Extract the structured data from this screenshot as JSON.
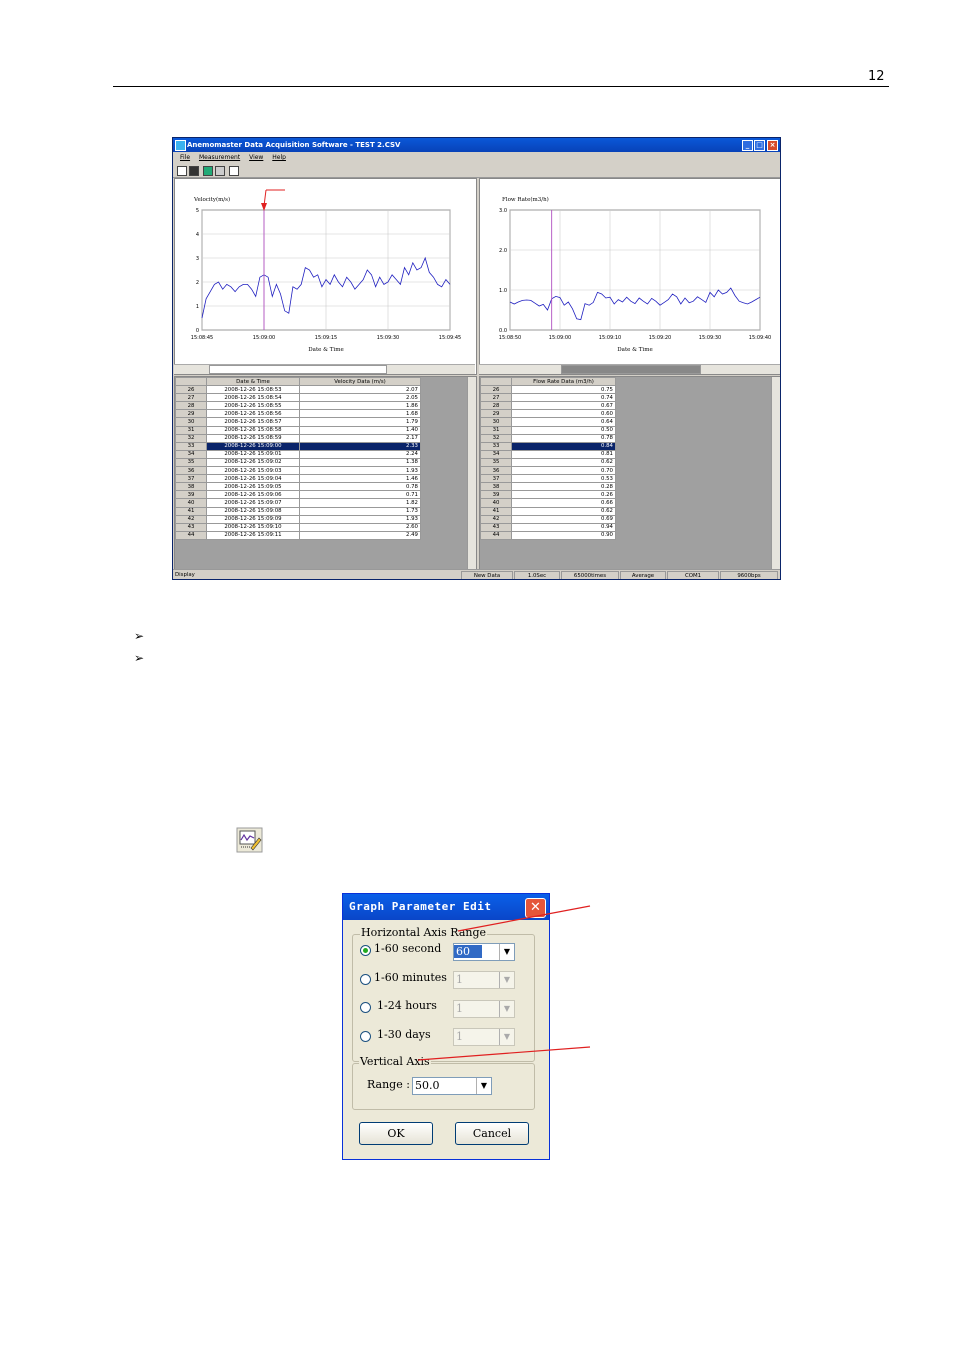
{
  "page": {
    "number": "12"
  },
  "app": {
    "title": "Anemomaster Data Acquisition Software - TEST 2.CSV",
    "menu": [
      "File",
      "Measurement",
      "View",
      "Help"
    ],
    "left_chart": {
      "ylabel": "Velocity(m/s)",
      "xlabel": "Date & Time"
    },
    "right_chart": {
      "ylabel": "Flow Rate(m3/h)",
      "xlabel": "Date & Time"
    },
    "left_grid": {
      "headers": [
        "",
        "Date & Time",
        "Velocity Data (m/s)"
      ]
    },
    "right_grid": {
      "headers": [
        "",
        "Flow Rate Data (m3/h)"
      ]
    },
    "rows": [
      {
        "n": "26",
        "dt": "2008-12-26 15:08:53",
        "v": "2.07",
        "f": "0.75"
      },
      {
        "n": "27",
        "dt": "2008-12-26 15:08:54",
        "v": "2.05",
        "f": "0.74"
      },
      {
        "n": "28",
        "dt": "2008-12-26 15:08:55",
        "v": "1.86",
        "f": "0.67"
      },
      {
        "n": "29",
        "dt": "2008-12-26 15:08:56",
        "v": "1.68",
        "f": "0.60"
      },
      {
        "n": "30",
        "dt": "2008-12-26 15:08:57",
        "v": "1.79",
        "f": "0.64"
      },
      {
        "n": "31",
        "dt": "2008-12-26 15:08:58",
        "v": "1.40",
        "f": "0.50"
      },
      {
        "n": "32",
        "dt": "2008-12-26 15:08:59",
        "v": "2.17",
        "f": "0.78"
      },
      {
        "n": "33",
        "dt": "2008-12-26 15:09:00",
        "v": "2.33",
        "f": "0.84"
      },
      {
        "n": "34",
        "dt": "2008-12-26 15:09:01",
        "v": "2.24",
        "f": "0.81"
      },
      {
        "n": "35",
        "dt": "2008-12-26 15:09:02",
        "v": "1.38",
        "f": "0.62"
      },
      {
        "n": "36",
        "dt": "2008-12-26 15:09:03",
        "v": "1.93",
        "f": "0.70"
      },
      {
        "n": "37",
        "dt": "2008-12-26 15:09:04",
        "v": "1.46",
        "f": "0.53"
      },
      {
        "n": "38",
        "dt": "2008-12-26 15:09:05",
        "v": "0.78",
        "f": "0.28"
      },
      {
        "n": "39",
        "dt": "2008-12-26 15:09:06",
        "v": "0.71",
        "f": "0.26"
      },
      {
        "n": "40",
        "dt": "2008-12-26 15:09:07",
        "v": "1.82",
        "f": "0.66"
      },
      {
        "n": "41",
        "dt": "2008-12-26 15:09:08",
        "v": "1.73",
        "f": "0.62"
      },
      {
        "n": "42",
        "dt": "2008-12-26 15:09:09",
        "v": "1.93",
        "f": "0.69"
      },
      {
        "n": "43",
        "dt": "2008-12-26 15:09:10",
        "v": "2.60",
        "f": "0.94"
      },
      {
        "n": "44",
        "dt": "2008-12-26 15:09:11",
        "v": "2.49",
        "f": "0.90"
      }
    ],
    "selected_row": "33",
    "status": [
      "Display",
      "New Data",
      "1.0Sec",
      "65000times",
      "Average",
      "COM1",
      "9600bps"
    ]
  },
  "chart_data": [
    {
      "type": "line",
      "ylabel": "Velocity(m/s)",
      "xlabel": "Date & Time",
      "ylim": [
        0,
        5
      ],
      "yticks": [
        "0",
        "1",
        "2",
        "3",
        "4",
        "5"
      ],
      "xticks": [
        "15:08:45",
        "15:09:00",
        "15:09:15",
        "15:09:30",
        "15:09:45"
      ],
      "cursor_index": 15,
      "x_start_index": 0,
      "x_end_index": 60,
      "values": [
        0.5,
        1.3,
        1.6,
        1.9,
        2.0,
        1.7,
        1.9,
        1.8,
        1.6,
        1.8,
        1.9,
        1.9,
        1.7,
        1.4,
        2.2,
        2.3,
        2.2,
        1.4,
        1.9,
        1.5,
        0.8,
        0.7,
        1.8,
        1.7,
        1.9,
        2.6,
        2.5,
        2.2,
        2.3,
        1.8,
        2.1,
        1.9,
        2.3,
        2.0,
        1.8,
        2.2,
        2.0,
        1.7,
        1.9,
        2.1,
        2.5,
        2.3,
        1.8,
        2.2,
        1.9,
        2.0,
        2.3,
        2.1,
        1.9,
        2.6,
        2.3,
        2.8,
        2.5,
        2.6,
        3.0,
        2.4,
        2.2,
        1.9,
        1.8,
        2.1,
        1.9
      ]
    },
    {
      "type": "line",
      "ylabel": "Flow Rate(m3/h)",
      "xlabel": "Date & Time",
      "ylim": [
        0,
        3
      ],
      "yticks": [
        "0.0",
        "1.0",
        "2.0",
        "3.0"
      ],
      "xticks": [
        "15:08:50",
        "15:09:00",
        "15:09:10",
        "15:09:20",
        "15:09:30",
        "15:09:40"
      ],
      "cursor_index": 10,
      "x_start_index": 0,
      "x_end_index": 60,
      "values": [
        0.7,
        0.65,
        0.7,
        0.74,
        0.75,
        0.74,
        0.67,
        0.6,
        0.64,
        0.5,
        0.78,
        0.84,
        0.81,
        0.62,
        0.7,
        0.53,
        0.28,
        0.26,
        0.66,
        0.62,
        0.69,
        0.94,
        0.9,
        0.8,
        0.82,
        0.65,
        0.76,
        0.7,
        0.82,
        0.72,
        0.66,
        0.8,
        0.72,
        0.65,
        0.79,
        0.72,
        0.62,
        0.69,
        0.76,
        0.9,
        0.83,
        0.65,
        0.8,
        0.68,
        0.72,
        0.83,
        0.76,
        0.69,
        0.94,
        0.83,
        1.0,
        0.9,
        0.94,
        1.05,
        0.86,
        0.72,
        0.68,
        0.65,
        0.7,
        0.76,
        0.82
      ]
    }
  ],
  "dialog": {
    "title": "Graph Parameter Edit",
    "horizontal_group": "Horizontal Axis Range",
    "options": [
      {
        "label": "1-60 second",
        "value": "60",
        "checked": true
      },
      {
        "label": "1-60 minutes",
        "value": "1",
        "checked": false
      },
      {
        "label": "1-24 hours",
        "value": "1",
        "checked": false
      },
      {
        "label": "1-30 days",
        "value": "1",
        "checked": false
      }
    ],
    "vertical_group": "Vertical Axis",
    "range_label": "Range :",
    "range_value": "50.0",
    "ok_label": "OK",
    "cancel_label": "Cancel"
  },
  "colors": {
    "line": "#2020c0",
    "cursor": "#b050c0",
    "annotation": "#e02020"
  }
}
